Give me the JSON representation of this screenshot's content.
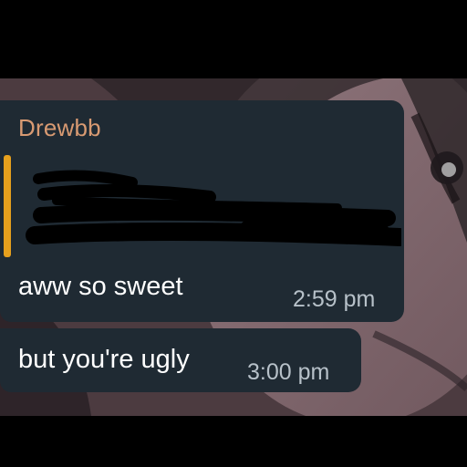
{
  "chat": {
    "messages": [
      {
        "sender": "Drewbb",
        "reply_preview": "",
        "text": "aww so sweet",
        "time": "2:59 pm"
      },
      {
        "text": "but you're ugly",
        "time": "3:00 pm"
      }
    ]
  },
  "colors": {
    "bubble_background": "#1f2a33",
    "sender_name": "#d89a72",
    "reply_bar": "#e6a01d",
    "timestamp": "#b7c1c9"
  },
  "icons": {
    "reply_redaction": "scribble-redaction"
  }
}
